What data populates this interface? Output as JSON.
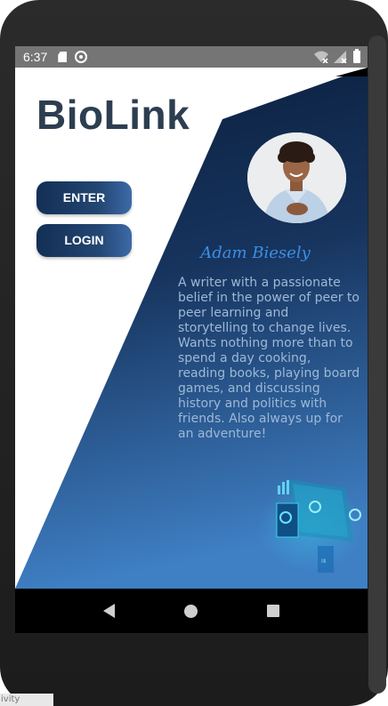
{
  "status_bar": {
    "time": "6:37"
  },
  "app": {
    "brand": "BioLink",
    "buttons": {
      "enter": "ENTER",
      "login": "LOGIN"
    },
    "profile": {
      "name": "Adam Biesely",
      "bio": "A writer with a passionate belief in the power of peer to peer learning and storytelling to change lives. Wants nothing more than to spend a day cooking, reading books, playing board games, and discussing history and politics with friends. Also always up for an adventure!"
    }
  },
  "nav_bar": {
    "icons": [
      "back-icon",
      "home-icon",
      "recents-icon"
    ]
  },
  "bottom_caption": "ivity",
  "colors": {
    "brand_text": "#2d3e50",
    "gradient_top": "#0a1e3c",
    "gradient_bottom": "#3f7fc4",
    "name_text": "#3d8ee0",
    "bio_text": "#9db9d6",
    "status_bar": "#757575",
    "nav_bar": "#000000"
  }
}
